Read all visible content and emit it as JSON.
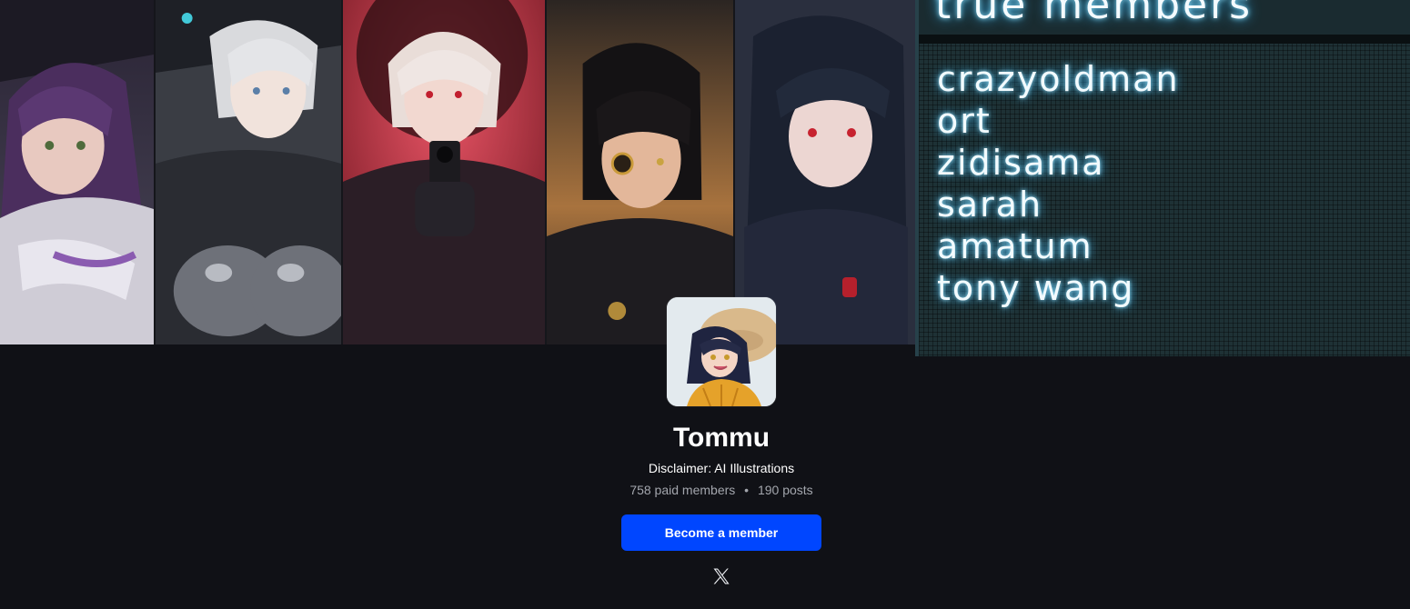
{
  "banner": {
    "board": {
      "title": "true members",
      "members": [
        "crazyoldman",
        "ort",
        "zidisama",
        "sarah",
        "amatum",
        "tony wang"
      ]
    }
  },
  "profile": {
    "name": "Tommu",
    "tagline": "Disclaimer: AI Illustrations",
    "members_text": "758 paid members",
    "separator": "•",
    "posts_text": "190 posts",
    "cta_label": "Become a member",
    "social_icon": "x-logo-icon"
  },
  "colors": {
    "background": "#101116",
    "accent": "#0046ff",
    "text": "#ffffff",
    "muted": "#a3a6ad",
    "board_glow": "#39bcff"
  }
}
